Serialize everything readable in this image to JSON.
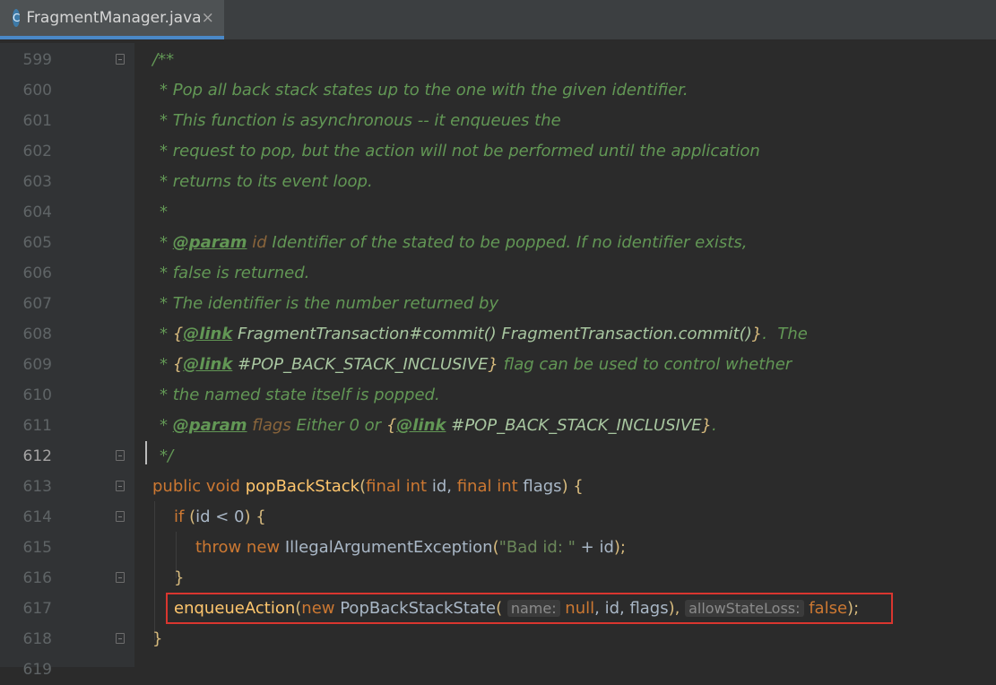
{
  "tab": {
    "title": "FragmentManager.java",
    "close": "×",
    "icon_text": "C"
  },
  "lines": [
    {
      "n": "599"
    },
    {
      "n": "600"
    },
    {
      "n": "601"
    },
    {
      "n": "602"
    },
    {
      "n": "603"
    },
    {
      "n": "604"
    },
    {
      "n": "605"
    },
    {
      "n": "606"
    },
    {
      "n": "607"
    },
    {
      "n": "608"
    },
    {
      "n": "609"
    },
    {
      "n": "610"
    },
    {
      "n": "611"
    },
    {
      "n": "612"
    },
    {
      "n": "613"
    },
    {
      "n": "614"
    },
    {
      "n": "615"
    },
    {
      "n": "616"
    },
    {
      "n": "617"
    },
    {
      "n": "618"
    },
    {
      "n": "619"
    }
  ],
  "code": {
    "l599": "/**",
    "l600": "* Pop all back stack states up to the one with the given identifier.",
    "l601": "* This function is asynchronous -- it enqueues the",
    "l602": "* request to pop, but the action will not be performed until the application",
    "l603": "* returns to its event loop.",
    "l604": "*",
    "l605_star": "* ",
    "l605_tag": "@param",
    "l605_name": " id",
    "l605_text": " Identifier of the stated to be popped. If no identifier exists,",
    "l606": "* false is returned.",
    "l607": "* The identifier is the number returned by",
    "l608_star": "* ",
    "l608_open": "{",
    "l608_tag": "@link",
    "l608_ref": " FragmentTransaction#commit() FragmentTransaction.commit()",
    "l608_close": "}",
    "l608_text": ".  The",
    "l609_star": "* ",
    "l609_open": "{",
    "l609_tag": "@link",
    "l609_ref": " #POP_BACK_STACK_INCLUSIVE",
    "l609_close": "}",
    "l609_text": " flag can be used to control whether",
    "l610": "* the named state itself is popped.",
    "l611_star": "* ",
    "l611_tag": "@param",
    "l611_name": " flags",
    "l611_text": " Either 0 or ",
    "l611_open": "{",
    "l611_tag2": "@link",
    "l611_ref": " #POP_BACK_STACK_INCLUSIVE",
    "l611_close": "}",
    "l611_end": ".",
    "l612": "*/",
    "l613_kw1": "public void ",
    "l613_fn": "popBackStack",
    "l613_p1": "(",
    "l613_kw2": "final int ",
    "l613_id1": "id, ",
    "l613_kw3": "final int ",
    "l613_id2": "flags",
    "l613_p2": ") {",
    "l614_kw": "if ",
    "l614_p1": "(",
    "l614_id": "id < 0",
    "l614_p2": ") {",
    "l615_kw": "throw new ",
    "l615_id": "IllegalArgumentException",
    "l615_p1": "(",
    "l615_str": "\"Bad id: \"",
    "l615_rest": " + id",
    "l615_p2": ");",
    "l616": "}",
    "l617_fn": "enqueueAction",
    "l617_p1": "(",
    "l617_kw1": "new ",
    "l617_id1": "PopBackStackState",
    "l617_p2": "( ",
    "l617_hint1": "name:",
    "l617_kw2": " null",
    "l617_id2": ", id, flags",
    "l617_p3": "), ",
    "l617_hint2": "allowStateLoss:",
    "l617_kw3": " false",
    "l617_p4": ");",
    "l618": "}"
  }
}
